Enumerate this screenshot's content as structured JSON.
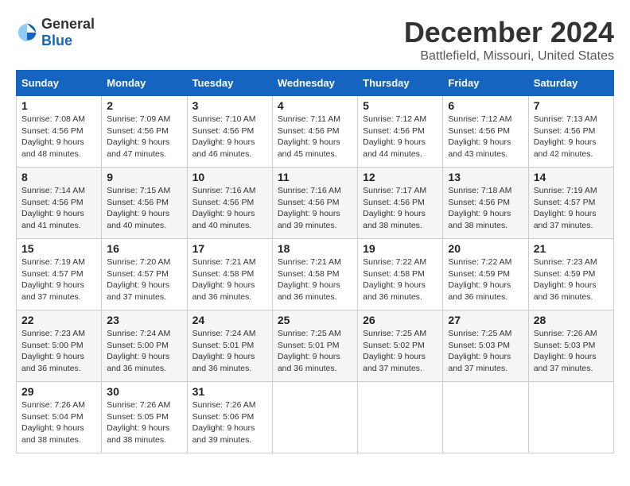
{
  "logo": {
    "general": "General",
    "blue": "Blue"
  },
  "title": "December 2024",
  "location": "Battlefield, Missouri, United States",
  "days_header": [
    "Sunday",
    "Monday",
    "Tuesday",
    "Wednesday",
    "Thursday",
    "Friday",
    "Saturday"
  ],
  "weeks": [
    [
      {
        "day": "1",
        "sunrise": "Sunrise: 7:08 AM",
        "sunset": "Sunset: 4:56 PM",
        "daylight": "Daylight: 9 hours and 48 minutes."
      },
      {
        "day": "2",
        "sunrise": "Sunrise: 7:09 AM",
        "sunset": "Sunset: 4:56 PM",
        "daylight": "Daylight: 9 hours and 47 minutes."
      },
      {
        "day": "3",
        "sunrise": "Sunrise: 7:10 AM",
        "sunset": "Sunset: 4:56 PM",
        "daylight": "Daylight: 9 hours and 46 minutes."
      },
      {
        "day": "4",
        "sunrise": "Sunrise: 7:11 AM",
        "sunset": "Sunset: 4:56 PM",
        "daylight": "Daylight: 9 hours and 45 minutes."
      },
      {
        "day": "5",
        "sunrise": "Sunrise: 7:12 AM",
        "sunset": "Sunset: 4:56 PM",
        "daylight": "Daylight: 9 hours and 44 minutes."
      },
      {
        "day": "6",
        "sunrise": "Sunrise: 7:12 AM",
        "sunset": "Sunset: 4:56 PM",
        "daylight": "Daylight: 9 hours and 43 minutes."
      },
      {
        "day": "7",
        "sunrise": "Sunrise: 7:13 AM",
        "sunset": "Sunset: 4:56 PM",
        "daylight": "Daylight: 9 hours and 42 minutes."
      }
    ],
    [
      {
        "day": "8",
        "sunrise": "Sunrise: 7:14 AM",
        "sunset": "Sunset: 4:56 PM",
        "daylight": "Daylight: 9 hours and 41 minutes."
      },
      {
        "day": "9",
        "sunrise": "Sunrise: 7:15 AM",
        "sunset": "Sunset: 4:56 PM",
        "daylight": "Daylight: 9 hours and 40 minutes."
      },
      {
        "day": "10",
        "sunrise": "Sunrise: 7:16 AM",
        "sunset": "Sunset: 4:56 PM",
        "daylight": "Daylight: 9 hours and 40 minutes."
      },
      {
        "day": "11",
        "sunrise": "Sunrise: 7:16 AM",
        "sunset": "Sunset: 4:56 PM",
        "daylight": "Daylight: 9 hours and 39 minutes."
      },
      {
        "day": "12",
        "sunrise": "Sunrise: 7:17 AM",
        "sunset": "Sunset: 4:56 PM",
        "daylight": "Daylight: 9 hours and 38 minutes."
      },
      {
        "day": "13",
        "sunrise": "Sunrise: 7:18 AM",
        "sunset": "Sunset: 4:56 PM",
        "daylight": "Daylight: 9 hours and 38 minutes."
      },
      {
        "day": "14",
        "sunrise": "Sunrise: 7:19 AM",
        "sunset": "Sunset: 4:57 PM",
        "daylight": "Daylight: 9 hours and 37 minutes."
      }
    ],
    [
      {
        "day": "15",
        "sunrise": "Sunrise: 7:19 AM",
        "sunset": "Sunset: 4:57 PM",
        "daylight": "Daylight: 9 hours and 37 minutes."
      },
      {
        "day": "16",
        "sunrise": "Sunrise: 7:20 AM",
        "sunset": "Sunset: 4:57 PM",
        "daylight": "Daylight: 9 hours and 37 minutes."
      },
      {
        "day": "17",
        "sunrise": "Sunrise: 7:21 AM",
        "sunset": "Sunset: 4:58 PM",
        "daylight": "Daylight: 9 hours and 36 minutes."
      },
      {
        "day": "18",
        "sunrise": "Sunrise: 7:21 AM",
        "sunset": "Sunset: 4:58 PM",
        "daylight": "Daylight: 9 hours and 36 minutes."
      },
      {
        "day": "19",
        "sunrise": "Sunrise: 7:22 AM",
        "sunset": "Sunset: 4:58 PM",
        "daylight": "Daylight: 9 hours and 36 minutes."
      },
      {
        "day": "20",
        "sunrise": "Sunrise: 7:22 AM",
        "sunset": "Sunset: 4:59 PM",
        "daylight": "Daylight: 9 hours and 36 minutes."
      },
      {
        "day": "21",
        "sunrise": "Sunrise: 7:23 AM",
        "sunset": "Sunset: 4:59 PM",
        "daylight": "Daylight: 9 hours and 36 minutes."
      }
    ],
    [
      {
        "day": "22",
        "sunrise": "Sunrise: 7:23 AM",
        "sunset": "Sunset: 5:00 PM",
        "daylight": "Daylight: 9 hours and 36 minutes."
      },
      {
        "day": "23",
        "sunrise": "Sunrise: 7:24 AM",
        "sunset": "Sunset: 5:00 PM",
        "daylight": "Daylight: 9 hours and 36 minutes."
      },
      {
        "day": "24",
        "sunrise": "Sunrise: 7:24 AM",
        "sunset": "Sunset: 5:01 PM",
        "daylight": "Daylight: 9 hours and 36 minutes."
      },
      {
        "day": "25",
        "sunrise": "Sunrise: 7:25 AM",
        "sunset": "Sunset: 5:01 PM",
        "daylight": "Daylight: 9 hours and 36 minutes."
      },
      {
        "day": "26",
        "sunrise": "Sunrise: 7:25 AM",
        "sunset": "Sunset: 5:02 PM",
        "daylight": "Daylight: 9 hours and 37 minutes."
      },
      {
        "day": "27",
        "sunrise": "Sunrise: 7:25 AM",
        "sunset": "Sunset: 5:03 PM",
        "daylight": "Daylight: 9 hours and 37 minutes."
      },
      {
        "day": "28",
        "sunrise": "Sunrise: 7:26 AM",
        "sunset": "Sunset: 5:03 PM",
        "daylight": "Daylight: 9 hours and 37 minutes."
      }
    ],
    [
      {
        "day": "29",
        "sunrise": "Sunrise: 7:26 AM",
        "sunset": "Sunset: 5:04 PM",
        "daylight": "Daylight: 9 hours and 38 minutes."
      },
      {
        "day": "30",
        "sunrise": "Sunrise: 7:26 AM",
        "sunset": "Sunset: 5:05 PM",
        "daylight": "Daylight: 9 hours and 38 minutes."
      },
      {
        "day": "31",
        "sunrise": "Sunrise: 7:26 AM",
        "sunset": "Sunset: 5:06 PM",
        "daylight": "Daylight: 9 hours and 39 minutes."
      },
      null,
      null,
      null,
      null
    ]
  ]
}
